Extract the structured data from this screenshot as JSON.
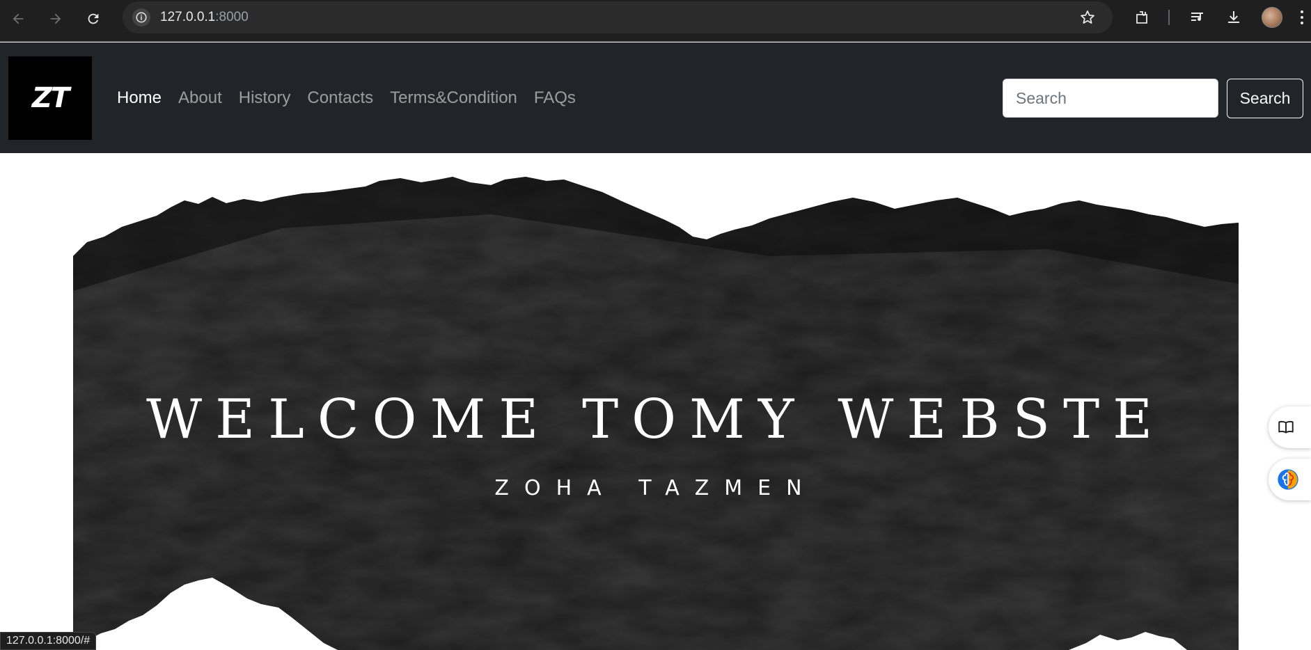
{
  "browser": {
    "url_host": "127.0.0.1",
    "url_port": ":8000",
    "status_url": "127.0.0.1:8000/#"
  },
  "site": {
    "logo_text": "ZT",
    "nav": [
      {
        "label": "Home",
        "active": true
      },
      {
        "label": "About",
        "active": false
      },
      {
        "label": "History",
        "active": false
      },
      {
        "label": "Contacts",
        "active": false
      },
      {
        "label": "Terms&Condition",
        "active": false
      },
      {
        "label": "FAQs",
        "active": false
      }
    ],
    "search_placeholder": "Search",
    "search_button": "Search"
  },
  "hero": {
    "title": "WELCOME TOMY WEBSTE",
    "subtitle": "ZOHA TAZMEN"
  },
  "colors": {
    "navbar_bg": "#212529",
    "browser_bg": "#1f1f1f",
    "hero_bg": "#1b1b1b"
  }
}
